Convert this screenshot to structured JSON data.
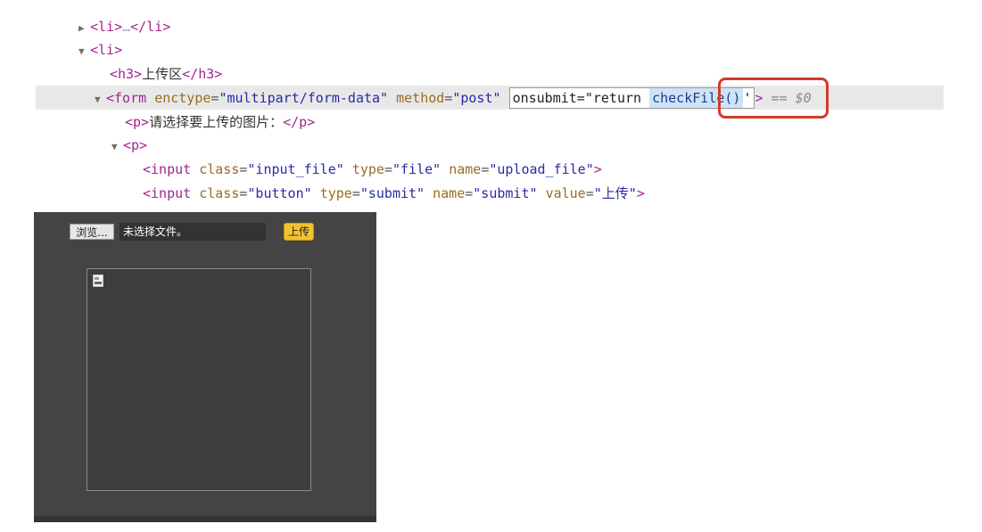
{
  "devtools": {
    "line1": {
      "tri": "▶",
      "open": "<li>",
      "ellipsis": "…",
      "close": "</li>"
    },
    "line2": {
      "tri": "▼",
      "open": "<li>"
    },
    "line3": {
      "open": "<h3>",
      "text": "上传区",
      "close": "</h3>"
    },
    "line4": {
      "tri": "▼",
      "tag_start": "<form",
      "attr1": "enctype",
      "val1": "\"multipart/form-data\"",
      "attr2": "method",
      "val2": "\"post\"",
      "onsubmit_text": "onsubmit=\"return",
      "checkfile": "checkFile()",
      "quote_end": "'",
      "tag_end": ">",
      "dollar": "== $0"
    },
    "line5": {
      "open": "<p>",
      "text": "请选择要上传的图片：",
      "close": "</p>"
    },
    "line6": {
      "tri": "▼",
      "open": "<p>"
    },
    "line7": {
      "tag_start": "<input",
      "attr1": "class",
      "val1": "\"input_file\"",
      "attr2": "type",
      "val2": "\"file\"",
      "attr3": "name",
      "val3": "\"upload_file\"",
      "tag_end": ">"
    },
    "line8": {
      "tag_start": "<input",
      "attr1": "class",
      "val1": "\"button\"",
      "attr2": "type",
      "val2": "\"submit\"",
      "attr3": "name",
      "val3": "\"submit\"",
      "attr4": "value",
      "val4": "\"上传\"",
      "tag_end": ">"
    }
  },
  "preview": {
    "browse_label": "浏览...",
    "file_status": "未选择文件。",
    "upload_label": "上传"
  },
  "colors": {
    "tag": "#a3258f",
    "attr": "#9a6d22",
    "value": "#2a2aa6",
    "highlight_ring": "#d33b2a",
    "upload_button": "#f2c12e",
    "preview_bg": "#444444"
  }
}
